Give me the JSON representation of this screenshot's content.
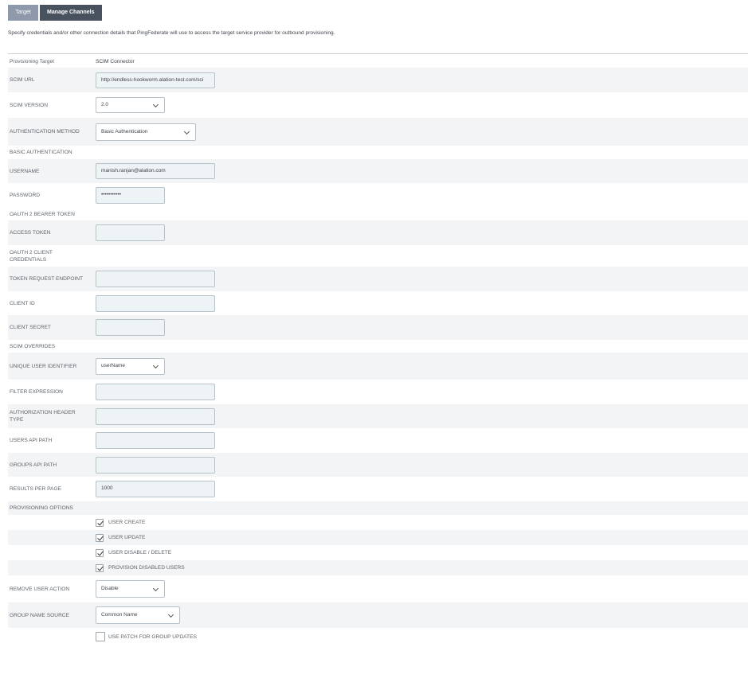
{
  "tabs": [
    {
      "label": "Target",
      "active": true
    },
    {
      "label": "Manage Channels",
      "active": false
    }
  ],
  "description": "Specify credentials and/or other connection details that PingFederate will use to access the target service provider for outbound provisioning.",
  "provisioning_target": {
    "label": "Provisioning Target",
    "value": "SCIM Connector"
  },
  "fields": {
    "scim_url": {
      "label": "SCIM URL",
      "value": "http://endless-hookworm.alation-test.com/sci"
    },
    "scim_version": {
      "label": "SCIM VERSION",
      "value": "2.0"
    },
    "auth_method": {
      "label": "AUTHENTICATION METHOD",
      "value": "Basic Authentication"
    },
    "basic_auth_header": {
      "label": "BASIC AUTHENTICATION"
    },
    "username": {
      "label": "USERNAME",
      "value": "manish.ranjan@alation.com"
    },
    "password": {
      "label": "PASSWORD",
      "value": "•••••••••••"
    },
    "oauth_bearer_header": {
      "label": "OAUTH 2 BEARER TOKEN"
    },
    "access_token": {
      "label": "ACCESS TOKEN",
      "value": ""
    },
    "oauth_client_header": {
      "label": "OAUTH 2 CLIENT CREDENTIALS"
    },
    "token_endpoint": {
      "label": "TOKEN REQUEST ENDPOINT",
      "value": ""
    },
    "client_id": {
      "label": "CLIENT ID",
      "value": ""
    },
    "client_secret": {
      "label": "CLIENT SECRET",
      "value": ""
    },
    "scim_overrides_header": {
      "label": "SCIM OVERRIDES"
    },
    "unique_user_id": {
      "label": "UNIQUE USER IDENTIFIER",
      "value": "userName"
    },
    "filter_expression": {
      "label": "FILTER EXPRESSION",
      "value": ""
    },
    "auth_header_type": {
      "label": "AUTHORIZATION HEADER TYPE",
      "value": ""
    },
    "users_api_path": {
      "label": "USERS API PATH",
      "value": ""
    },
    "groups_api_path": {
      "label": "GROUPS API PATH",
      "value": ""
    },
    "results_per_page": {
      "label": "RESULTS PER PAGE",
      "value": "1000"
    },
    "prov_options_header": {
      "label": "PROVISIONING OPTIONS"
    },
    "remove_user_action": {
      "label": "REMOVE USER ACTION",
      "value": "Disable"
    },
    "group_name_source": {
      "label": "GROUP NAME SOURCE",
      "value": "Common Name"
    }
  },
  "checkboxes": {
    "user_create": {
      "label": "USER CREATE",
      "checked": true
    },
    "user_update": {
      "label": "USER UPDATE",
      "checked": true
    },
    "user_disable": {
      "label": "USER DISABLE / DELETE",
      "checked": true
    },
    "provision_disabled": {
      "label": "PROVISION DISABLED USERS",
      "checked": true
    },
    "use_patch": {
      "label": "USE PATCH FOR GROUP UPDATES",
      "checked": false
    }
  }
}
